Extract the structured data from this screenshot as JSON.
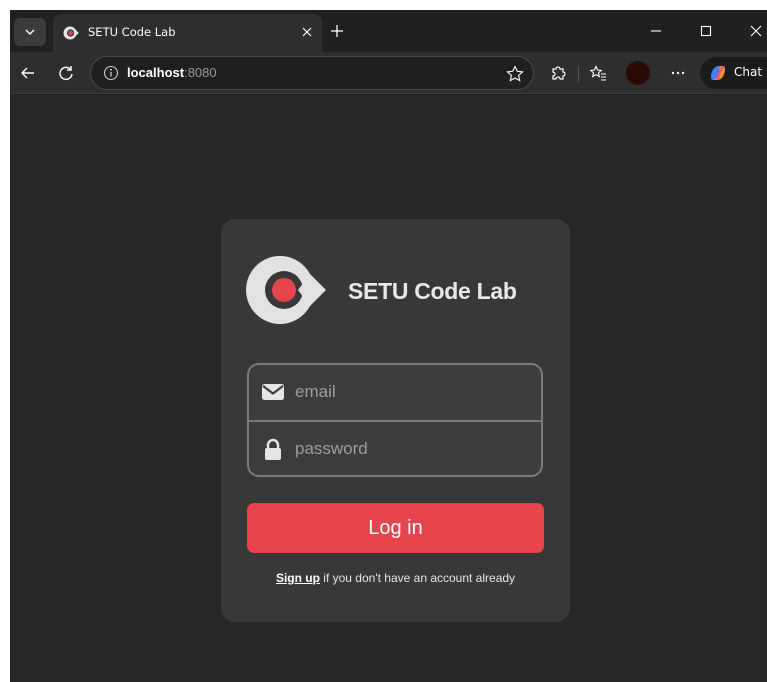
{
  "browser": {
    "tab_title": "SETU Code Lab",
    "url_host": "localhost",
    "url_port": ":8080",
    "chat_label": "Chat"
  },
  "icons": {
    "tab_list": "chevron-down-icon",
    "tab_close": "close-icon",
    "new_tab": "plus-icon",
    "minimize": "minimize-icon",
    "maximize": "maximize-icon",
    "close_window": "close-icon",
    "back": "back-arrow-icon",
    "refresh": "refresh-icon",
    "site_info": "info-icon",
    "favorite": "star-icon",
    "extensions": "puzzle-icon",
    "favorites": "favorites-list-icon",
    "more": "more-icon",
    "email": "envelope-icon",
    "password": "lock-icon"
  },
  "login": {
    "brand_name": "SETU Code Lab",
    "email_placeholder": "email",
    "password_placeholder": "password",
    "login_label": "Log in",
    "signup_link": "Sign up",
    "signup_text": " if you don't have an account already"
  },
  "colors": {
    "accent": "#e5444d",
    "card": "#383838",
    "page_bg": "#262626"
  }
}
